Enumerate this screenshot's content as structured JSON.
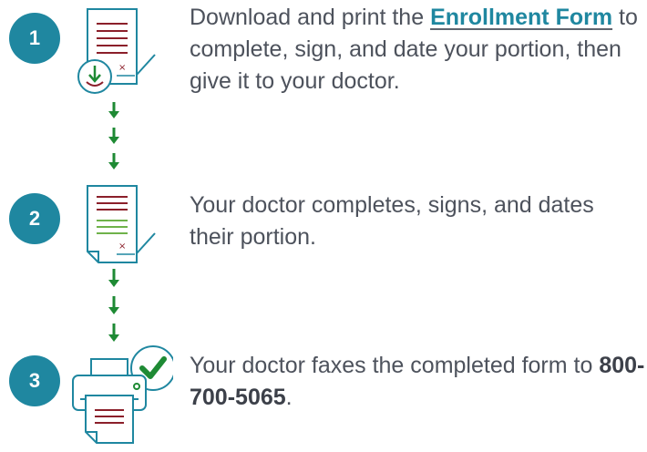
{
  "steps": [
    {
      "number": "1",
      "text_before": "Download and print the ",
      "link_text": "Enrollment Form",
      "text_after": " to complete, sign, and date your portion, then give it to your doctor.",
      "icon": "document-download-icon"
    },
    {
      "number": "2",
      "text": "Your doctor completes, signs, and dates their portion.",
      "icon": "document-sign-icon"
    },
    {
      "number": "3",
      "text_before": "Your doctor faxes the completed form to ",
      "phone": "800-700-5065",
      "text_after": ".",
      "icon": "fax-check-icon"
    }
  ],
  "connector_icon": "arrow-down-icon",
  "colors": {
    "badge": "#1f87a0",
    "link": "#1f87a0",
    "arrow": "#1e8a34",
    "doc_lines_red": "#8b1f2a",
    "doc_lines_green": "#6fb24a",
    "icon_stroke": "#1f87a0",
    "check": "#1e8a34"
  }
}
